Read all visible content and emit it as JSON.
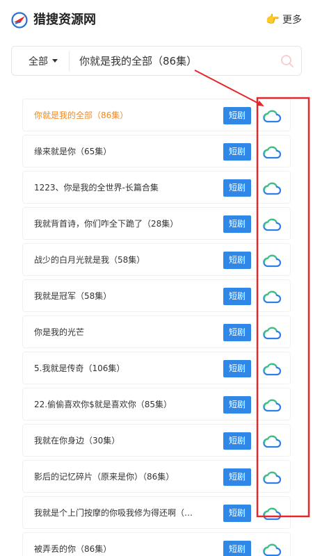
{
  "header": {
    "site_title": "猎搜资源网",
    "more_icon": "pointing-hand-icon",
    "more_label": "更多"
  },
  "search": {
    "filter_label": "全部",
    "query": "你就是我的全部（86集）",
    "search_icon": "search-icon"
  },
  "results": [
    {
      "title": "你就是我的全部（86集）",
      "tag": "短剧",
      "active": true
    },
    {
      "title": "缘来就是你（65集）",
      "tag": "短剧"
    },
    {
      "title": "1223、你是我的全世界-长篇合集",
      "tag": "短剧"
    },
    {
      "title": "我就背首诗，你们咋全下跪了（28集）",
      "tag": "短剧"
    },
    {
      "title": "战少的白月光就是我（58集）",
      "tag": "短剧"
    },
    {
      "title": "我就是冠军（58集）",
      "tag": "短剧"
    },
    {
      "title": "你是我的光芒",
      "tag": "短剧"
    },
    {
      "title": "5.我就是传奇（106集）",
      "tag": "短剧"
    },
    {
      "title": "22.偷偷喜欢你$就是喜欢你（85集）",
      "tag": "短剧"
    },
    {
      "title": "我就在你身边（30集）",
      "tag": "短剧"
    },
    {
      "title": "影后的记忆碎片（原来是你）（86集）",
      "tag": "短剧"
    },
    {
      "title": "我就是个上门按摩的你吸我修为得还啊（…",
      "tag": "短剧"
    },
    {
      "title": "被弄丢的你（86集）",
      "tag": "短剧"
    }
  ],
  "colors": {
    "active_title": "#f08a24",
    "tag_bg": "#2f88e8",
    "annotation_red": "#e5262b"
  }
}
